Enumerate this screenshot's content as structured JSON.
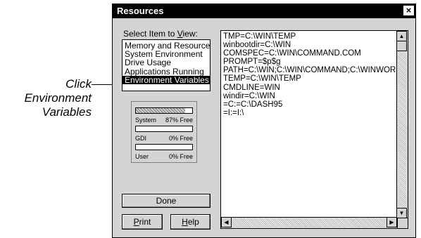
{
  "callout": {
    "line1": "Click",
    "line2": "Environment",
    "line3": "Variables"
  },
  "window": {
    "title": "Resources",
    "close_glyph": "×"
  },
  "select_label_parts": [
    "Select Item to ",
    "V",
    "iew:"
  ],
  "list_items": [
    {
      "label": "Memory and Resources",
      "selected": false
    },
    {
      "label": "System Environment",
      "selected": false
    },
    {
      "label": "Drive Usage",
      "selected": false
    },
    {
      "label": "Applications Running",
      "selected": false
    },
    {
      "label": "Environment Variables",
      "selected": true
    }
  ],
  "meters": [
    {
      "name": "System",
      "free": "87% Free",
      "fraction": 0.87
    },
    {
      "name": "GDI",
      "free": "0% Free",
      "fraction": 0.0
    },
    {
      "name": "User",
      "free": "0% Free",
      "fraction": 0.0
    }
  ],
  "buttons": {
    "done": "Done",
    "print_mnemonic": "P",
    "print_rest": "rint",
    "help_mnemonic": "H",
    "help_rest": "elp"
  },
  "env_lines": [
    "TMP=C:\\WIN\\TEMP",
    "winbootdir=C:\\WIN",
    "COMSPEC=C:\\WIN\\COMMAND.COM",
    "PROMPT=$p$g",
    "PATH=C:\\WIN;C:\\WIN\\COMMAND;C:\\WINWORD",
    "TEMP=C:\\WIN\\TEMP",
    "CMDLINE=WIN",
    "windir=C:\\WIN",
    "=C:=C:\\DASH95",
    "=I:=I:\\"
  ],
  "scroll_glyphs": {
    "up": "▲",
    "down": "▼",
    "left": "◀",
    "right": "▶"
  }
}
